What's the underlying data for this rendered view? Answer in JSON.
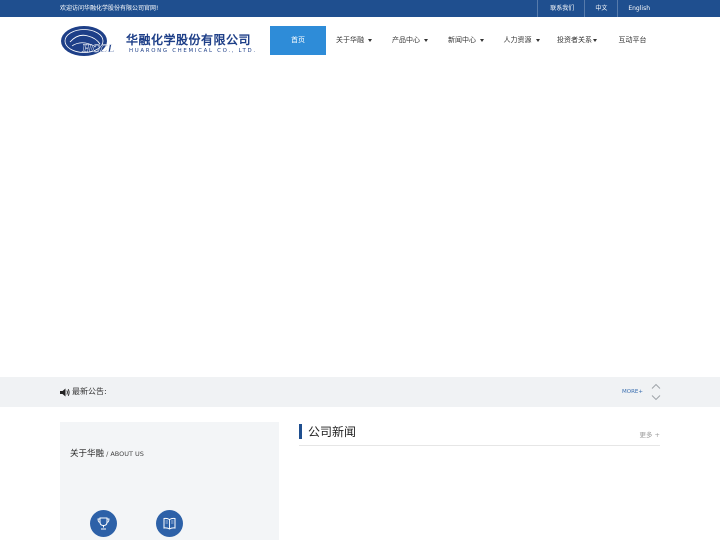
{
  "topbar": {
    "welcome": "欢迎访问华融化学股份有限公司官网!",
    "links": [
      "联系我们",
      "中文",
      "English"
    ]
  },
  "logo": {
    "mark_text": "HCCL",
    "name_cn": "华融化学股份有限公司",
    "name_en": "HUARONG CHEMICAL CO., LTD."
  },
  "nav": {
    "items": [
      {
        "label": "首页",
        "dropdown": false,
        "active": true
      },
      {
        "label": "关于华融",
        "dropdown": true,
        "active": false
      },
      {
        "label": "产品中心",
        "dropdown": true,
        "active": false
      },
      {
        "label": "新闻中心",
        "dropdown": true,
        "active": false
      },
      {
        "label": "人力资源",
        "dropdown": true,
        "active": false
      },
      {
        "label": "投资者关系",
        "dropdown": true,
        "active": false
      },
      {
        "label": "互动平台",
        "dropdown": false,
        "active": false
      }
    ]
  },
  "notice": {
    "label": "最新公告:",
    "more": "MORE+"
  },
  "about": {
    "title": "关于华融",
    "subtitle": " / ABOUT US"
  },
  "news": {
    "title": "公司新闻",
    "more": "更多 +"
  },
  "colors": {
    "topbar": "#1f4f8f",
    "nav_active": "#2e8cd8",
    "brand": "#1e3f88",
    "icon_circle": "#2d61a8"
  },
  "icons": [
    "speaker-icon",
    "chevron-up-icon",
    "chevron-down-icon",
    "trophy-icon",
    "book-icon"
  ]
}
